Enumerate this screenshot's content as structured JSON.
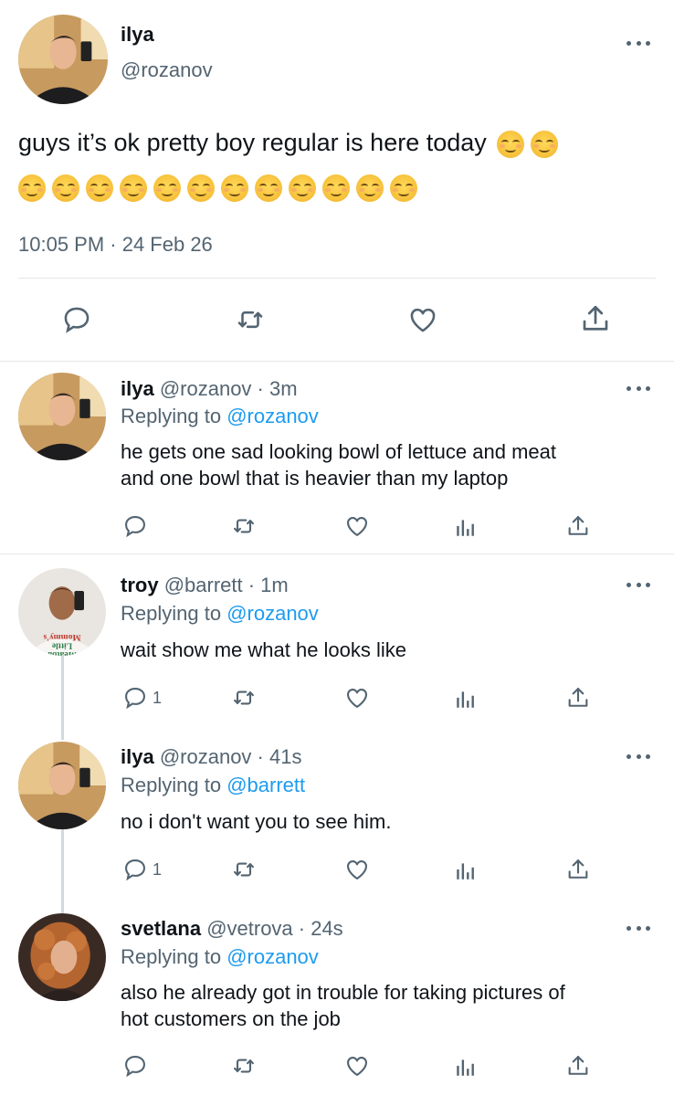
{
  "main_tweet": {
    "name": "ilya",
    "handle": "@rozanov",
    "text_line1": "guys it’s ok pretty boy regular is here today",
    "emoji_line1_count": 2,
    "emoji_line2_count": 12,
    "emoji_name": "smiling-face-emoji",
    "timestamp": "10:05 PM · 24 Feb 26"
  },
  "replies": [
    {
      "name": "ilya",
      "meta": "@rozanov · 3m",
      "replying_prefix": "Replying to ",
      "replying_to": "@rozanov",
      "text_lines": [
        "he gets one sad looking bowl of lettuce and meat",
        "and one bowl that is heavier than my laptop"
      ],
      "reply_count": ""
    },
    {
      "name": "troy",
      "meta": "@barrett · 1m",
      "replying_prefix": "Replying to ",
      "replying_to": "@rozanov",
      "text_lines": [
        "wait show me what he looks like"
      ],
      "reply_count": "1"
    },
    {
      "name": "ilya",
      "meta": "@rozanov · 41s",
      "replying_prefix": "Replying to ",
      "replying_to": "@barrett",
      "text_lines": [
        "no i don't want you to see him."
      ],
      "reply_count": "1"
    },
    {
      "name": "svetlana",
      "meta": "@vetrova · 24s",
      "replying_prefix": "Replying to ",
      "replying_to": "@rozanov",
      "text_lines": [
        "also he already got in trouble for taking pictures of",
        "hot customers on the job"
      ],
      "reply_count": ""
    }
  ],
  "shirt_text": [
    "Mommy's",
    "Little",
    "Meatba"
  ],
  "colors": {
    "link": "#1d9bf0",
    "secondary_text": "#536471",
    "divider": "#e4e7ea",
    "thread_line": "#cfd9de"
  }
}
